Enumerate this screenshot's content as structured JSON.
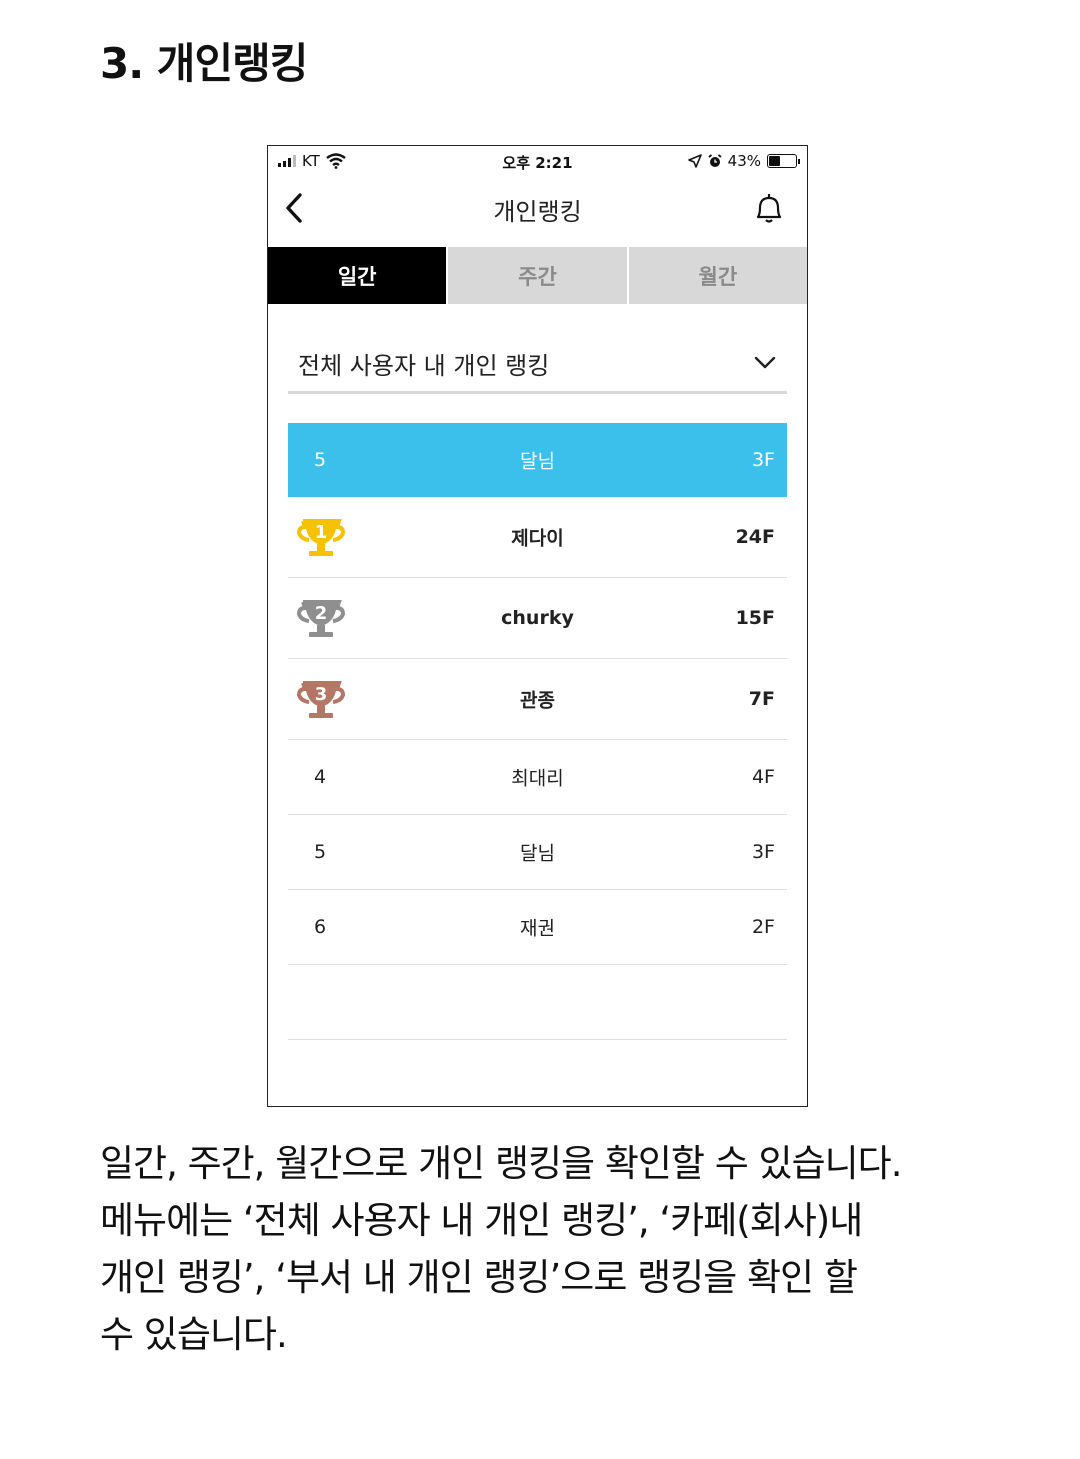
{
  "doc": {
    "title": "3. 개인랭킹",
    "description": [
      "일간, 주간, 월간으로 개인 랭킹을 확인할  수 있습니다.",
      "메뉴에는 ‘전체 사용자 내 개인 랭킹’, ‘카페(회사)내",
      "개인 랭킹’, ‘부서 내 개인 랭킹’으로 랭킹을 확인 할",
      "수 있습니다."
    ]
  },
  "status_bar": {
    "carrier": "KT",
    "time": "오후 2:21",
    "battery": "43%",
    "battery_level": 0.43
  },
  "nav": {
    "title": "개인랭킹",
    "back_icon": "chevron-left-icon",
    "bell_icon": "bell-icon"
  },
  "tabs": [
    {
      "label": "일간",
      "active": true
    },
    {
      "label": "주간",
      "active": false
    },
    {
      "label": "월간",
      "active": false
    }
  ],
  "filter": {
    "selected": "전체 사용자 내 개인 랭킹",
    "icon": "chevron-down-icon"
  },
  "my_rank": {
    "rank": "5",
    "name": "달님",
    "floors": "3F"
  },
  "podium": [
    {
      "rank": "1",
      "name": "제다이",
      "floors": "24F",
      "trophy_color": "#f5c100"
    },
    {
      "rank": "2",
      "name": "churky",
      "floors": "15F",
      "trophy_color": "#8f8f8f"
    },
    {
      "rank": "3",
      "name": "관종",
      "floors": "7F",
      "trophy_color": "#b47766"
    }
  ],
  "others": [
    {
      "rank": "4",
      "name": "최대리",
      "floors": "4F"
    },
    {
      "rank": "5",
      "name": "달님",
      "floors": "3F"
    },
    {
      "rank": "6",
      "name": "재권",
      "floors": "2F"
    }
  ],
  "colors": {
    "highlight": "#3ac0ea",
    "tab_active_bg": "#000000",
    "tab_inactive_bg": "#d8d8d8"
  }
}
